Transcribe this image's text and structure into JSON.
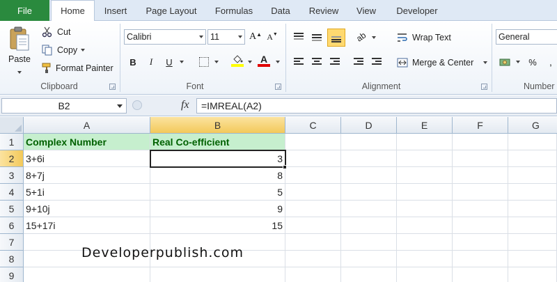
{
  "tabs": {
    "file": "File",
    "items": [
      "Home",
      "Insert",
      "Page Layout",
      "Formulas",
      "Data",
      "Review",
      "View",
      "Developer"
    ],
    "active": "Home"
  },
  "ribbon": {
    "clipboard": {
      "label": "Clipboard",
      "paste": "Paste",
      "cut": "Cut",
      "copy": "Copy",
      "format_painter": "Format Painter"
    },
    "font": {
      "label": "Font",
      "name": "Calibri",
      "size": "11",
      "bold": "B",
      "italic": "I",
      "underline": "U",
      "grow": "A",
      "shrink": "A",
      "fill_color": "#ffff00",
      "font_color": "#e00000"
    },
    "alignment": {
      "label": "Alignment",
      "wrap_text": "Wrap Text",
      "merge_center": "Merge & Center"
    },
    "number": {
      "label": "Number",
      "format": "General",
      "percent": "%"
    }
  },
  "formula_bar": {
    "name_box": "B2",
    "fx": "fx",
    "formula": "=IMREAL(A2)"
  },
  "grid": {
    "columns": [
      "A",
      "B",
      "C",
      "D",
      "E",
      "F",
      "G"
    ],
    "selected_column": "B",
    "rows": [
      "1",
      "2",
      "3",
      "4",
      "5",
      "6",
      "7",
      "8",
      "9"
    ],
    "selected_row": "2",
    "header": {
      "a": "Complex Number",
      "b": "Real Co-efficient"
    },
    "data": [
      {
        "a": "3+6i",
        "b": "3"
      },
      {
        "a": "8+7j",
        "b": "8"
      },
      {
        "a": "5+1i",
        "b": "5"
      },
      {
        "a": "9+10j",
        "b": "9"
      },
      {
        "a": "15+17i",
        "b": "15"
      }
    ],
    "header_fill": "#c6efce",
    "header_text_color": "#006100"
  },
  "watermark": "Developerpublish.com"
}
